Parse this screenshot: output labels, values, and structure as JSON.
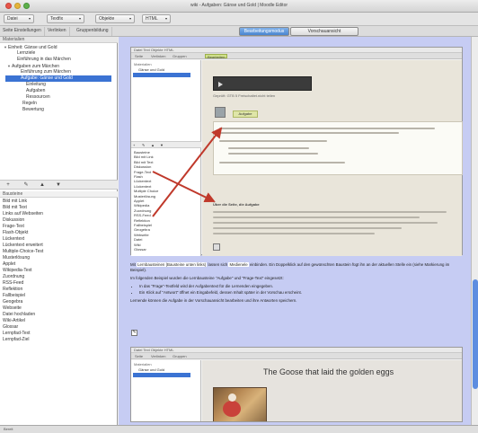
{
  "window": {
    "title": "wiki - Aufgaben: Gänse und Gold | Moodle Editor",
    "menus": [
      {
        "label": "Datei",
        "arrow": "▾"
      },
      {
        "label": "Textfix",
        "arrow": "▾"
      },
      {
        "label": "Objekte",
        "arrow": "▾"
      },
      {
        "label": "HTML",
        "arrow": "▾"
      }
    ],
    "toolbar_tabs": [
      "Seite Einstellungen",
      "Verlinken",
      "Gruppenbildung"
    ],
    "view_tabs": {
      "active": "Bearbeitungsmodus",
      "inactive": "Vorschauansicht"
    }
  },
  "left": {
    "tree_header": "Materialien",
    "tree": [
      {
        "label": "Einheit: Gänse und Gold",
        "arrow": "▼"
      },
      {
        "label": "Lernziele",
        "arrow": ""
      },
      {
        "label": "Einführung in das Märchen",
        "arrow": ""
      },
      {
        "label": "Aufgaben zum Märchen",
        "arrow": "▼"
      },
      {
        "label": "Einführung zum Märchen",
        "arrow": ""
      },
      {
        "label": "Aufgabe: Gänse und Gold",
        "arrow": ""
      },
      {
        "label": "Einleitung",
        "arrow": ""
      },
      {
        "label": "Aufgaben",
        "arrow": ""
      },
      {
        "label": "Ressourcen",
        "arrow": ""
      },
      {
        "label": "Regeln",
        "arrow": ""
      },
      {
        "label": "Bewertung",
        "arrow": ""
      }
    ],
    "tool_icons": [
      "add-icon",
      "edit-icon",
      "move-up-icon",
      "delete-icon"
    ],
    "tool_glyphs": [
      "+",
      "✎",
      "▲",
      "▼"
    ],
    "list_header": "Bausteine",
    "list": [
      "Bild mit Link",
      "Bild mit Text",
      "Links auf Webseiten",
      "Diskussion",
      "Frage-Text",
      "Flash-Objekt",
      "Lückentext",
      "Lückentext erweitert",
      "Multiple-Choice-Test",
      "Musterlösung",
      "Applet",
      "Wikipedia-Text",
      "Zuordnung",
      "RSS-Feed",
      "Reflektion",
      "Fallbeispiel",
      "Geogebra",
      "Webseite",
      "Datei hochladen",
      "Wiki-Artikel",
      "Glossar",
      "Lernpfad-Text",
      "Lernpfad-Ziel"
    ]
  },
  "preview1": {
    "menu": "Datei  Text  Objekte  HTML",
    "tabs": [
      "Seite",
      "Verlinken",
      "Gruppen",
      "Bearbeiten"
    ],
    "left_items": [
      "Materialien",
      "Gänse und Gold"
    ],
    "tools": [
      "+",
      "✎",
      "▲",
      "▼"
    ],
    "list": [
      "Bausteine",
      "Bild mit Link",
      "Bild mit Text",
      "Diskussion",
      "Frage-Text",
      "Flash",
      "Lückentext",
      "Lückentext",
      "Multiple Choice",
      "Musterlösung",
      "Applet",
      "Wikipedia",
      "Zuordnung",
      "RSS-Feed",
      "Reflektion",
      "Fallbeispiel",
      "Geogebra",
      "Webseite",
      "Datei",
      "Wiki",
      "Glossar"
    ],
    "caption": "Geprüft: GTB 5 Freischaltet.nicht teilen",
    "badge": "Aufgabe",
    "section_label": "Über die Seite, die Aufgabe"
  },
  "body_text": {
    "para1_prefix": "Mit",
    "para1_highlight1": "Lernbausteinen (Bausteine unten links)",
    "para1_mid": "lassen sich",
    "para1_highlight2": "Medienele",
    "para1_rest": "einbinden. Ein Doppelklick auf den gewünschten Baustein fügt ihn an der aktuellen Stelle ein (siehe Markierung im Beispiel).",
    "para2": "Im folgenden Beispiel wurden die Lernbausteine \"Aufgabe\" und \"Frage-Text\" eingesetzt:",
    "bullets": [
      "In das \"Frage\"-Textfeld wird der Aufgabentext für die Lernenden eingegeben.",
      "Ein Klick auf \"Antwort\" öffnet ein Eingabefeld, dessen Inhalt später in der Vorschau erscheint."
    ],
    "para3": "Lernende können die Aufgabe in der Vorschauansicht bearbeiten und ihre Antworten speichern."
  },
  "preview2": {
    "menu": "Datei  Text  Objekte  HTML",
    "tabs": [
      "Seite",
      "Verlinken",
      "Gruppen"
    ],
    "left_items": [
      "Materialien",
      "Gänse und Gold"
    ],
    "title": "The Goose that laid the golden eggs"
  },
  "status": {
    "text": "Bereit"
  },
  "colors": {
    "accent": "#3b73d3",
    "arrow": "#c0392b",
    "pane_bg": "#c6ccf3"
  }
}
